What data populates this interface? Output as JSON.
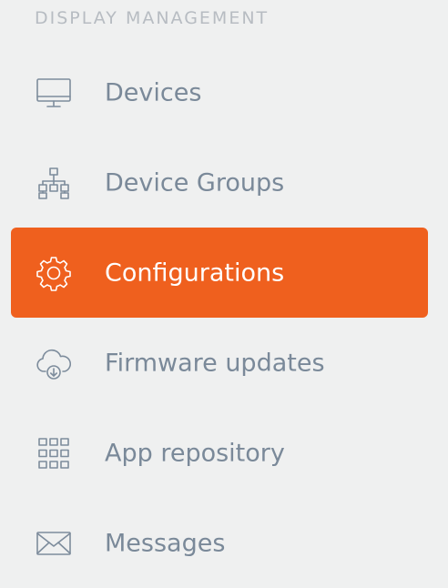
{
  "section": {
    "title": "DISPLAY MANAGEMENT"
  },
  "colors": {
    "background": "#eff0f0",
    "accent": "#ef601e",
    "text": "#7a8999",
    "section_title": "#b7bcc2",
    "active_text": "#ffffff"
  },
  "nav": {
    "items": [
      {
        "label": "Devices",
        "icon": "monitor-icon",
        "active": false
      },
      {
        "label": "Device Groups",
        "icon": "hierarchy-icon",
        "active": false
      },
      {
        "label": "Configurations",
        "icon": "gear-icon",
        "active": true
      },
      {
        "label": "Firmware updates",
        "icon": "cloud-download-icon",
        "active": false
      },
      {
        "label": "App repository",
        "icon": "grid-icon",
        "active": false
      },
      {
        "label": "Messages",
        "icon": "envelope-icon",
        "active": false
      }
    ]
  }
}
